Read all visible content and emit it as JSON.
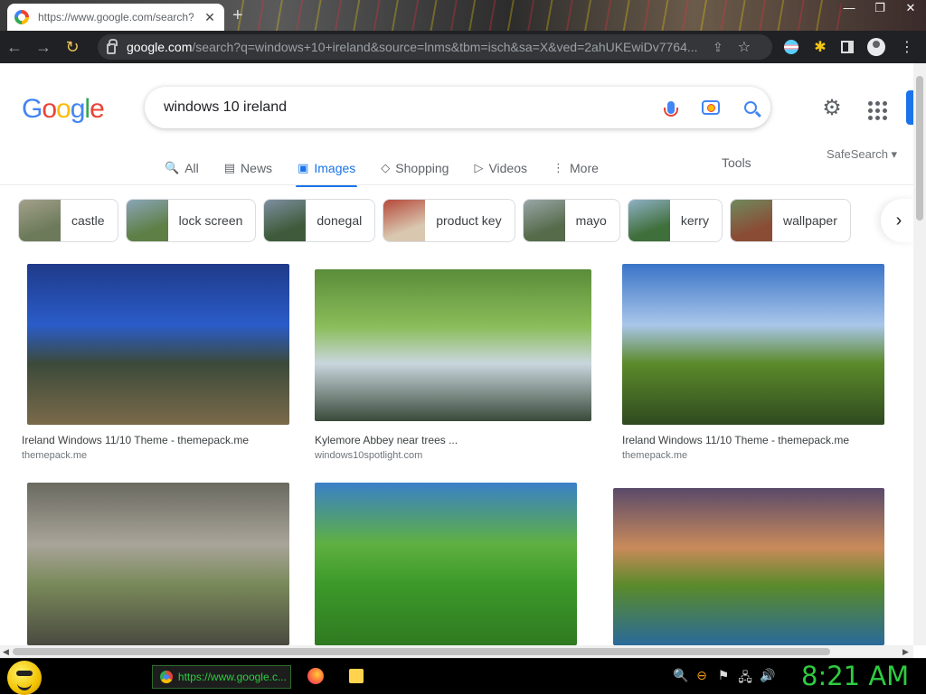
{
  "browser": {
    "tab_title": "https://www.google.com/search?",
    "tab_close": "✕",
    "new_tab": "+",
    "window_controls": [
      "—",
      "❐",
      "✕"
    ],
    "url_domain": "google.com",
    "url_path": "/search?q=windows+10+ireland&source=lnms&tbm=isch&sa=X&ved=2ahUKEwiDv7764...",
    "nav": {
      "back": "←",
      "forward": "→",
      "reload": "↻"
    },
    "star": "☆",
    "share": "⇪",
    "menu": "⋮",
    "puzzle": "✱"
  },
  "search": {
    "logo_letters": [
      "G",
      "o",
      "o",
      "g",
      "l",
      "e"
    ],
    "query": "windows 10 ireland",
    "gear": "⚙"
  },
  "tabs": [
    {
      "label": "All",
      "icon": "🔍"
    },
    {
      "label": "News",
      "icon": "▤"
    },
    {
      "label": "Images",
      "icon": "▣",
      "active": true
    },
    {
      "label": "Shopping",
      "icon": "◇"
    },
    {
      "label": "Videos",
      "icon": "▷"
    },
    {
      "label": "More",
      "icon": "⋮"
    }
  ],
  "tools_label": "Tools",
  "safesearch_label": "SafeSearch ▾",
  "chips": [
    {
      "label": "castle",
      "colors": [
        "#6d7a5a",
        "#a3a18a"
      ]
    },
    {
      "label": "lock screen",
      "colors": [
        "#5e7f45",
        "#8aa5b8"
      ]
    },
    {
      "label": "donegal",
      "colors": [
        "#3e5a3a",
        "#7d8fa0"
      ]
    },
    {
      "label": "product key",
      "colors": [
        "#d9c7b0",
        "#b5493a"
      ]
    },
    {
      "label": "mayo",
      "colors": [
        "#556b4a",
        "#9aa6a8"
      ]
    },
    {
      "label": "kerry",
      "colors": [
        "#3f6f3a",
        "#8fb0c6"
      ]
    },
    {
      "label": "wallpaper",
      "colors": [
        "#8a4c35",
        "#6f8a5e"
      ]
    }
  ],
  "chip_next": "›",
  "results": [
    {
      "title": "Ireland Windows 11/10 Theme - themepack.me",
      "source": "themepack.me",
      "colors": [
        "#1f3a8a",
        "#2a5cc9",
        "#3c4a3a",
        "#7a6a4a"
      ]
    },
    {
      "title": "Kylemore Abbey near trees ...",
      "source": "windows10spotlight.com",
      "colors": [
        "#5a8c3a",
        "#8bbd5a",
        "#c9d6dd",
        "#3a4a3a"
      ]
    },
    {
      "title": "Ireland Windows 11/10 Theme - themepack.me",
      "source": "themepack.me",
      "colors": [
        "#3a74c8",
        "#a9c6ea",
        "#5b8a2a",
        "#2f4a20"
      ]
    },
    {
      "title": "",
      "source": "",
      "colors": [
        "#6a6a60",
        "#a9a49a",
        "#7a8a5a",
        "#4a4a40"
      ]
    },
    {
      "title": "",
      "source": "",
      "colors": [
        "#3a80c8",
        "#5fb040",
        "#3c9a2a",
        "#2f7a20"
      ]
    },
    {
      "title": "",
      "source": "",
      "colors": [
        "#5a4a6a",
        "#c98a5a",
        "#5a8a2a",
        "#2a6a9a"
      ]
    }
  ],
  "taskbar": {
    "chrome_task": "https://www.google.c...",
    "tray_icons": [
      "🔍",
      "⊖",
      "⚑",
      "🖧",
      "🔊"
    ],
    "clock": "8:21 AM"
  }
}
